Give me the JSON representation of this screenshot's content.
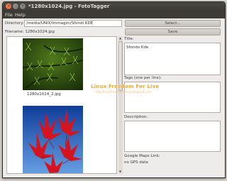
{
  "window": {
    "title": "*1280x1024.jpg - FotoTagger",
    "close_glyph": "×",
    "min_glyph": "–",
    "max_glyph": "+"
  },
  "menu": {
    "file": "File",
    "help": "Help"
  },
  "directory": {
    "label": "Directory:",
    "value": "/media/UNIX/Immagini/Sfondi KDE",
    "select_button": "Select..."
  },
  "file": {
    "label": "Filename: 1280x1024.jpg",
    "save_button": "Save"
  },
  "gallery": {
    "items": [
      {
        "caption": "1280x1024_2.jpg"
      },
      {
        "caption": ""
      }
    ]
  },
  "metadata": {
    "title_label": "Title:",
    "title_value": "Sfondo Kde",
    "tags_label": "Tags (one per line):",
    "tags_value": "",
    "description_label": "Description:",
    "description_value": "",
    "maps_label": "Google Maps Link:",
    "gps_status": "no GPS data"
  },
  "watermark": {
    "title": "Linux Freedom For Live",
    "url": "http://linuxfreedomforlive.blogspot.com"
  }
}
